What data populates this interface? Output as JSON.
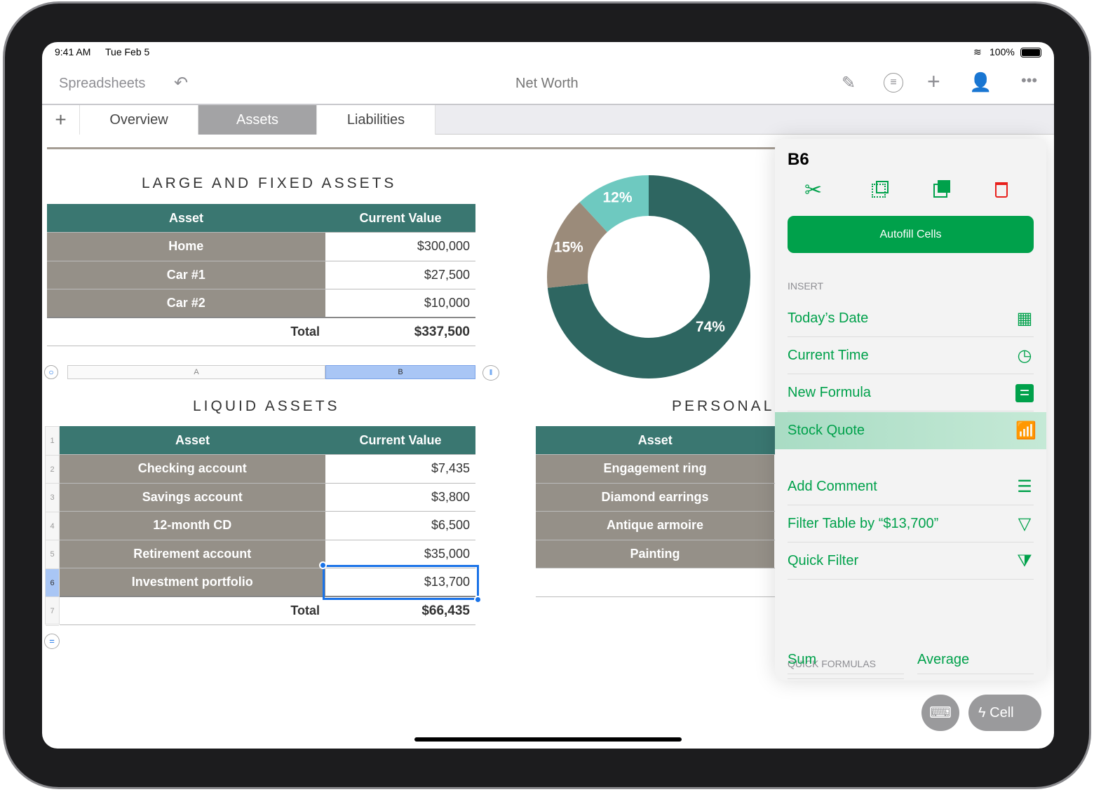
{
  "status": {
    "time": "9:41 AM",
    "date": "Tue Feb 5",
    "battery": "100%"
  },
  "toolbar": {
    "back_label": "Spreadsheets",
    "title": "Net Worth"
  },
  "tabs": [
    {
      "label": "Overview"
    },
    {
      "label": "Assets",
      "active": true
    },
    {
      "label": "Liabilities"
    }
  ],
  "large": {
    "title": "LARGE AND FIXED ASSETS",
    "headers": [
      "Asset",
      "Current Value"
    ],
    "rows": [
      [
        "Home",
        "$300,000"
      ],
      [
        "Car #1",
        "$27,500"
      ],
      [
        "Car #2",
        "$10,000"
      ]
    ],
    "total_label": "Total",
    "total": "$337,500"
  },
  "columns": {
    "a": "A",
    "b": "B"
  },
  "liquid": {
    "title": "LIQUID ASSETS",
    "headers": [
      "Asset",
      "Current Value"
    ],
    "rows": [
      [
        "Checking account",
        "$7,435"
      ],
      [
        "Savings account",
        "$3,800"
      ],
      [
        "12-month CD",
        "$6,500"
      ],
      [
        "Retirement account",
        "$35,000"
      ],
      [
        "Investment portfolio",
        "$13,700"
      ]
    ],
    "total_label": "Total",
    "total": "$66,435",
    "row_numbers": [
      "1",
      "2",
      "3",
      "4",
      "5",
      "6",
      "7"
    ]
  },
  "personal": {
    "title": "PERSONAL",
    "headers": [
      "Asset"
    ],
    "rows": [
      "Engagement ring",
      "Diamond earrings",
      "Antique armoire",
      "Painting"
    ]
  },
  "donut": {
    "slices": [
      {
        "label": "74%",
        "value": 74,
        "color": "#2e6661"
      },
      {
        "label": "15%",
        "value": 15,
        "color": "#9b8b7a"
      },
      {
        "label": "12%",
        "value": 12,
        "color": "#6ec9c0"
      }
    ]
  },
  "panel": {
    "cell": "B6",
    "autofill": "Autofill Cells",
    "insert_label": "INSERT",
    "items": [
      {
        "label": "Today’s Date",
        "icon": "calendar-icon"
      },
      {
        "label": "Current Time",
        "icon": "clock-icon"
      },
      {
        "label": "New Formula",
        "icon": "equals-icon"
      },
      {
        "label": "Stock Quote",
        "icon": "stock-chart-icon"
      },
      {
        "label": "Add Comment",
        "icon": "comment-icon"
      },
      {
        "label": "Filter Table by “$13,700”",
        "icon": "filter-icon"
      },
      {
        "label": "Quick Filter",
        "icon": "quick-filter-icon"
      }
    ],
    "quick_formulas_label": "QUICK FORMULAS",
    "formulas": [
      "Sum",
      "Average"
    ]
  },
  "bottom": {
    "cell_button": "Cell"
  },
  "colors": {
    "accent": "#00a14b",
    "header": "#3a7771",
    "name_cell": "#959088",
    "delete": "#e8201c"
  }
}
